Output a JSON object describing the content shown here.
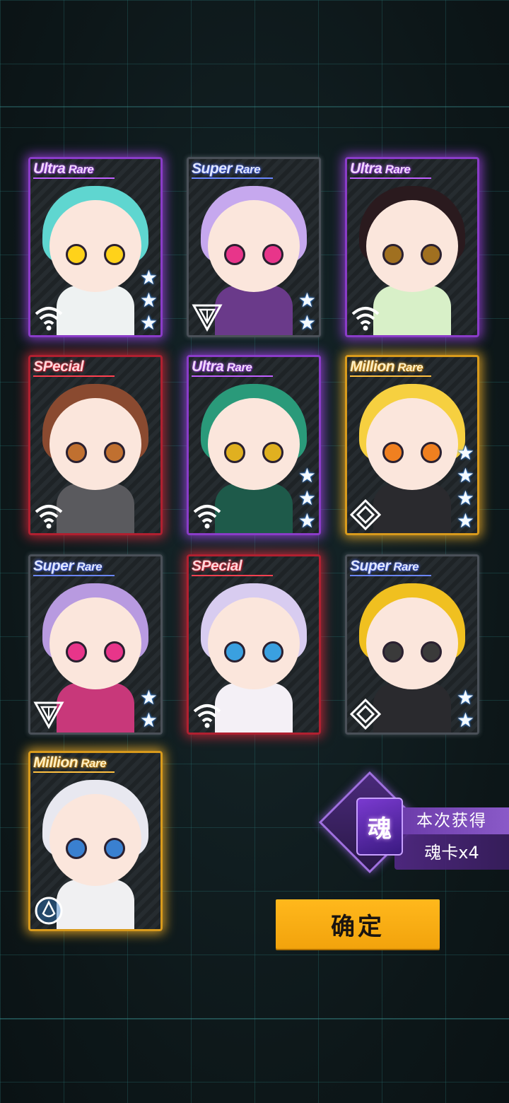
{
  "cards": [
    {
      "rarity_main": "Ultra",
      "rarity_sub": "Rare",
      "stars": 3,
      "type_icon": "wifi-icon",
      "theme": "ur",
      "hair": "#5fd6d0",
      "eyes": "#ffd21a",
      "body": "#eef2f2"
    },
    {
      "rarity_main": "Super",
      "rarity_sub": "Rare",
      "stars": 2,
      "type_icon": "triangle-icon",
      "theme": "sr",
      "hair": "#c6a8ee",
      "eyes": "#e8358a",
      "body": "#6a3a8a"
    },
    {
      "rarity_main": "Ultra",
      "rarity_sub": "Rare",
      "stars": 0,
      "type_icon": "wifi-icon",
      "theme": "ur",
      "hair": "#2a1a1e",
      "eyes": "#a07020",
      "body": "#d8f0c8"
    },
    {
      "rarity_main": "SPecial",
      "rarity_sub": "",
      "stars": 0,
      "type_icon": "wifi-icon",
      "theme": "sp",
      "hair": "#8a4a30",
      "eyes": "#c07030",
      "body": "#5a5a5e"
    },
    {
      "rarity_main": "Ultra",
      "rarity_sub": "Rare",
      "stars": 3,
      "type_icon": "wifi-icon",
      "theme": "ur",
      "hair": "#2a9a7a",
      "eyes": "#e0b020",
      "body": "#1e5a4a"
    },
    {
      "rarity_main": "Million",
      "rarity_sub": "Rare",
      "stars": 4,
      "type_icon": "diamond-icon",
      "theme": "mr",
      "hair": "#f6d040",
      "eyes": "#f08020",
      "body": "#2a2a2e"
    },
    {
      "rarity_main": "Super",
      "rarity_sub": "Rare",
      "stars": 2,
      "type_icon": "triangle-icon",
      "theme": "sr",
      "hair": "#b89ae0",
      "eyes": "#e8358a",
      "body": "#c8387a"
    },
    {
      "rarity_main": "SPecial",
      "rarity_sub": "",
      "stars": 0,
      "type_icon": "wifi-icon",
      "theme": "sp",
      "hair": "#d8ccf0",
      "eyes": "#3aa0e0",
      "body": "#f4f0f6"
    },
    {
      "rarity_main": "Super",
      "rarity_sub": "Rare",
      "stars": 2,
      "type_icon": "diamond-icon",
      "theme": "sr",
      "hair": "#f0c020",
      "eyes": "#3a3a3a",
      "body": "#2a2a2e"
    },
    {
      "rarity_main": "Million",
      "rarity_sub": "Rare",
      "stars": 0,
      "type_icon": "circle-drop-icon",
      "theme": "mr",
      "hair": "#e8e8f0",
      "eyes": "#3a80d0",
      "body": "#f0f0f2"
    }
  ],
  "reward": {
    "soul_glyph": "魂",
    "title": "本次获得",
    "item": "魂卡x4"
  },
  "confirm_label": "确定"
}
